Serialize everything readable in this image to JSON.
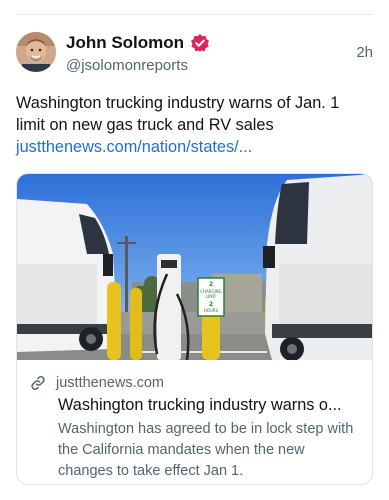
{
  "post": {
    "display_name": "John Solomon",
    "handle": "@jsolomonreports",
    "timestamp": "2h",
    "text": "Washington trucking industry warns of Jan. 1 limit on new gas truck and RV sales",
    "link": "justthenews.com/nation/states/..."
  },
  "card": {
    "domain": "justthenews.com",
    "title": "Washington trucking industry warns o...",
    "description": "Washington has agreed to be in lock step with the California mandates when the new changes to take effect Jan 1.",
    "image_alt": "Electric trucks parked at charging stations",
    "sign_text": [
      "2",
      "CHARGING",
      "LIMIT",
      "2",
      "HOURS"
    ]
  },
  "colors": {
    "verified": "#e0245e",
    "link": "#1d6fd6",
    "secondary_text": "#536471"
  },
  "icons": {
    "verified": "verified-badge-icon",
    "link": "link-icon"
  }
}
